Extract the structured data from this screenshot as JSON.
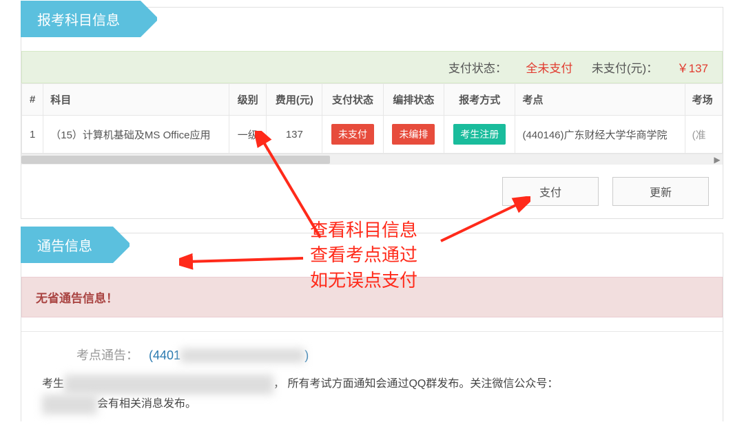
{
  "panel1": {
    "title": "报考科目信息"
  },
  "statusBar": {
    "label": "支付状态：",
    "status": "全未支付",
    "amountLabel": "未支付(元)：",
    "amount": "￥137"
  },
  "table": {
    "headers": {
      "idx": "#",
      "subject": "科目",
      "level": "级别",
      "fee": "费用(元)",
      "payState": "支付状态",
      "arrangeState": "编排状态",
      "method": "报考方式",
      "site": "考点",
      "extra": "考场"
    },
    "row": {
      "idx": "1",
      "subject": "（15）计算机基础及MS Office应用",
      "level": "一级",
      "fee": "137",
      "payState": "未支付",
      "arrangeState": "未编排",
      "method": "考生注册",
      "site": "(440146)广东财经大学华商学院",
      "extra": "(准"
    }
  },
  "buttons": {
    "pay": "支付",
    "refresh": "更新"
  },
  "panel2": {
    "title": "通告信息"
  },
  "alert": {
    "text": "无省通告信息！"
  },
  "notice": {
    "label": "考点通告：",
    "siteCodePrefix": "(4401",
    "body_prefix": "考生",
    "body_mid": "， 所有考试方面通知会通过QQ群发布。关注微信公众号：",
    "body_suffix": "会有相关消息发布。"
  },
  "annotation": {
    "line1": "查看科目信息",
    "line2": "查看考点通过",
    "line3": "如无误点支付"
  }
}
